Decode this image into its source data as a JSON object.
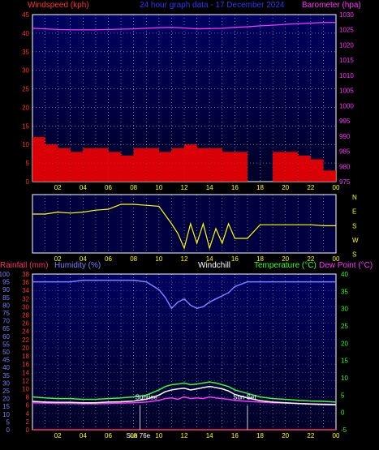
{
  "header_top": {
    "left_label": "Windspeed (kph)",
    "center_label": "24 hour graph data - 17 December 2024",
    "right_label": "Barometer (hpa)"
  },
  "header_bottom": {
    "rain_label": "Rainfall (mm)",
    "humidity_label": "Humidity (%)",
    "windchill_label": "Windchill",
    "temp_label": "Temperature (°C)",
    "dew_label": "Dew Point (°C)"
  },
  "colors": {
    "panel_bg_top": "#000066",
    "panel_bg_bottom": "#000030",
    "windspeed": "#ff0000",
    "gust": "#ffffff",
    "wind_avg": "#00ff00",
    "barometer": "#ff33ff",
    "direction": "#ffff00",
    "rain": "#ff3366",
    "humidity": "#7f7fff",
    "windchill": "#ffffff",
    "temperature": "#33ff33",
    "dewpoint": "#ff33ff",
    "tick_left": "#ff3333",
    "tick_right_top": "#ff33ff",
    "tick_right_bottom": "#33ff33",
    "tick_bottom": "#ffff00"
  },
  "chart_data": [
    {
      "type": "line",
      "title": "24 hour graph data - 17 December 2024",
      "x_tick_labels": [
        "02",
        "04",
        "06",
        "08",
        "10",
        "12",
        "14",
        "16",
        "18",
        "20",
        "22",
        "00"
      ],
      "y_left": {
        "label": "Windspeed (kph)",
        "ticks": [
          0,
          5,
          10,
          15,
          20,
          25,
          30,
          35,
          40,
          45
        ],
        "ylim": [
          0,
          45
        ]
      },
      "y_right": {
        "label": "Barometer (hpa)",
        "ticks": [
          975,
          980,
          985,
          990,
          995,
          1000,
          1005,
          1010,
          1015,
          1020,
          1025,
          1030
        ],
        "ylim": [
          975,
          1030
        ]
      },
      "hours": [
        0,
        1,
        2,
        3,
        4,
        5,
        6,
        7,
        8,
        9,
        10,
        11,
        12,
        13,
        14,
        15,
        16,
        17,
        18,
        19,
        20,
        21,
        22,
        23,
        24
      ],
      "series": [
        {
          "name": "Windspeed (kph)",
          "axis": "left",
          "values": [
            12,
            10,
            9,
            8,
            9,
            9,
            8,
            7,
            9,
            9,
            8,
            9,
            10,
            9,
            9,
            8,
            8,
            0,
            0,
            8,
            8,
            7,
            6,
            3,
            null
          ]
        },
        {
          "name": "Barometer (hpa)",
          "axis": "right",
          "values": [
            1025.5,
            1025.3,
            1025.1,
            1025.0,
            1025.0,
            1025.0,
            1025.1,
            1025.2,
            1025.3,
            1025.5,
            1025.7,
            1025.8,
            1025.6,
            1025.3,
            1025.4,
            1025.5,
            1025.8,
            1026.0,
            1026.3,
            1026.5,
            1026.8,
            1027.0,
            1027.2,
            1027.4,
            1027.4
          ]
        }
      ]
    },
    {
      "type": "line",
      "x_tick_labels": [
        "02",
        "04",
        "06",
        "08",
        "10",
        "12",
        "14",
        "16",
        "18",
        "20",
        "22",
        "00"
      ],
      "y_labels": [
        "N",
        "E",
        "S",
        "W",
        "S"
      ],
      "hours": [
        0,
        1,
        2,
        3,
        4,
        5,
        6,
        7,
        8,
        9,
        10,
        11,
        11.5,
        12,
        12.5,
        13,
        13.5,
        14,
        14.5,
        15,
        15.5,
        16,
        16.5,
        17,
        18,
        19,
        20,
        21,
        22,
        23,
        24
      ],
      "series": [
        {
          "name": "Wind direction",
          "values": [
            40,
            40,
            42,
            41,
            42,
            44,
            45,
            50,
            50,
            49,
            48,
            30,
            20,
            5,
            30,
            10,
            30,
            5,
            25,
            10,
            30,
            15,
            15,
            15,
            29,
            29,
            29,
            29,
            29,
            28,
            28
          ]
        }
      ]
    },
    {
      "type": "line",
      "x_tick_labels": [
        "02",
        "04",
        "06",
        "08",
        "10",
        "12",
        "14",
        "16",
        "18",
        "20",
        "22",
        "00"
      ],
      "y_left_rain": {
        "label": "Rainfall (mm)",
        "ticks": [
          0,
          2,
          4,
          6,
          8,
          10,
          12,
          14,
          16,
          18,
          20,
          22,
          24,
          26,
          28,
          30,
          32,
          34,
          36,
          38
        ]
      },
      "y_left_humidity": {
        "label": "Humidity (%)",
        "ticks": [
          0,
          5,
          10,
          15,
          20,
          25,
          30,
          35,
          40,
          45,
          50,
          55,
          60,
          65,
          70,
          75,
          80,
          85,
          90,
          95,
          100
        ]
      },
      "y_right": {
        "label": "Temperature (°C) Dew Point (°C)",
        "ticks": [
          -5,
          0,
          5,
          10,
          15,
          20,
          25,
          30,
          35,
          40
        ],
        "ylim": [
          -5,
          40
        ]
      },
      "annotations": [
        "Sunrise",
        "Sun Set",
        "Sun 76e"
      ],
      "hours": [
        0,
        1,
        2,
        3,
        4,
        5,
        6,
        7,
        8,
        9,
        10,
        10.5,
        11,
        11.5,
        12,
        12.5,
        13,
        13.5,
        14,
        14.5,
        15,
        15.5,
        16,
        17,
        18,
        19,
        20,
        21,
        22,
        23,
        24
      ],
      "series": [
        {
          "name": "Humidity (%)",
          "axis": "humidity",
          "values": [
            95,
            95,
            95,
            95,
            96,
            96,
            96,
            96,
            96,
            95,
            90,
            85,
            78,
            82,
            84,
            80,
            78,
            79,
            82,
            84,
            86,
            88,
            92,
            95,
            95,
            95,
            95,
            95,
            95,
            95,
            95
          ]
        },
        {
          "name": "Temperature (°C)",
          "axis": "right",
          "values": [
            4.5,
            4.2,
            4.0,
            4.0,
            3.8,
            3.8,
            4.0,
            4.2,
            4.5,
            5.0,
            6.5,
            7.5,
            8.0,
            8.2,
            8.5,
            8.0,
            8.2,
            8.5,
            8.8,
            8.5,
            8.0,
            7.5,
            6.5,
            5.5,
            4.5,
            4.0,
            3.8,
            3.5,
            3.3,
            3.2,
            3.0
          ]
        },
        {
          "name": "Dew Point (°C)",
          "axis": "right",
          "values": [
            2.8,
            2.7,
            2.6,
            2.6,
            2.5,
            2.5,
            2.6,
            2.7,
            2.8,
            3.0,
            3.5,
            4.0,
            4.2,
            3.8,
            4.5,
            4.0,
            4.2,
            4.0,
            4.5,
            4.2,
            4.0,
            3.8,
            3.5,
            3.2,
            3.0,
            2.8,
            2.7,
            2.6,
            2.5,
            2.4,
            2.3
          ]
        },
        {
          "name": "Windchill",
          "axis": "right",
          "values": [
            3.2,
            3.0,
            2.9,
            2.9,
            2.8,
            2.8,
            3.0,
            3.1,
            3.3,
            3.8,
            5.0,
            6.0,
            6.5,
            6.8,
            7.0,
            6.5,
            6.8,
            7.2,
            7.5,
            7.2,
            6.8,
            6.2,
            5.2,
            4.2,
            3.4,
            3.0,
            2.8,
            2.6,
            2.4,
            2.3,
            2.2
          ]
        },
        {
          "name": "Rainfall (mm)",
          "axis": "rain",
          "values": [
            0,
            0,
            0,
            0,
            0,
            0,
            0,
            0,
            0,
            0,
            0,
            0,
            0,
            0,
            0,
            0,
            0,
            0,
            0,
            0,
            0,
            0,
            0,
            0,
            0,
            0,
            0,
            0,
            0,
            0,
            0
          ]
        }
      ]
    }
  ]
}
